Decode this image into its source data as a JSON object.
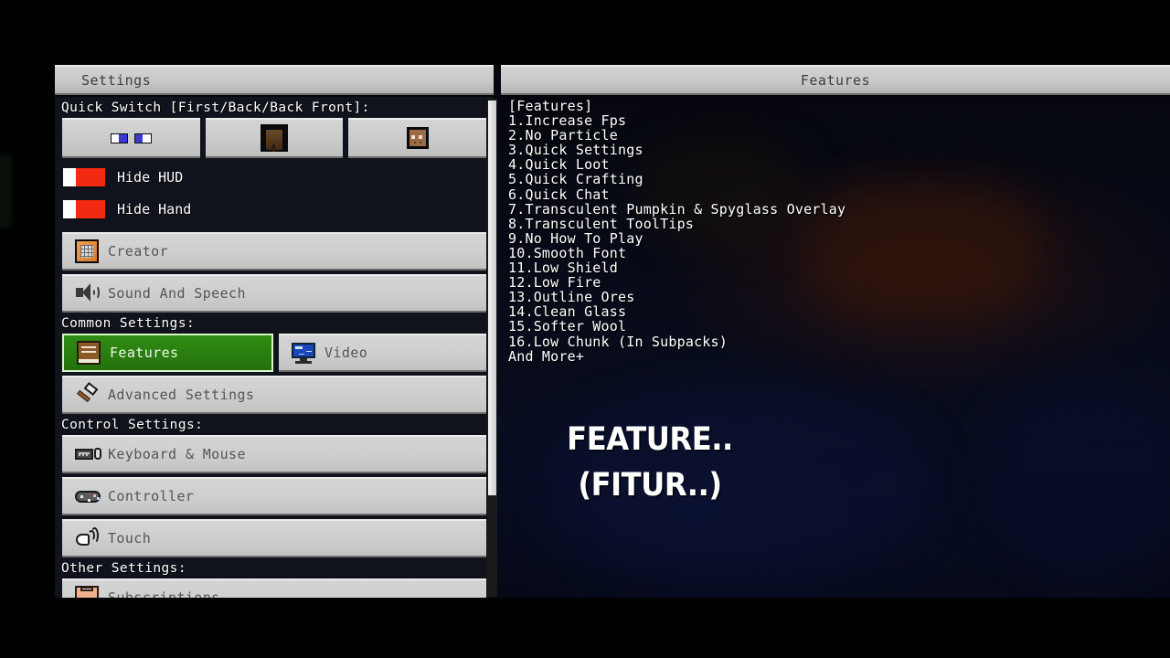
{
  "window": {
    "left_title": "Settings",
    "right_title": "Features"
  },
  "left_panel": {
    "quick_switch_label": "Quick Switch [First/Back/Back Front]:",
    "quick_switch_buttons": [
      {
        "name": "first-person-view",
        "icon": "toggle-pair-icon"
      },
      {
        "name": "back-view",
        "icon": "player-back-icon"
      },
      {
        "name": "back-front-view",
        "icon": "player-face-icon"
      }
    ],
    "toggles": [
      {
        "label": "Hide HUD",
        "state": "off"
      },
      {
        "label": "Hide Hand",
        "state": "off"
      }
    ],
    "top_rows": [
      {
        "label": "Creator",
        "icon": "creator-icon"
      },
      {
        "label": "Sound And Speech",
        "icon": "speaker-icon"
      }
    ],
    "sections": [
      {
        "label": "Common Settings:",
        "rows": [
          {
            "label": "Features",
            "icon": "book-icon",
            "selected": true
          },
          {
            "label": "Video",
            "icon": "monitor-icon",
            "selected": false
          },
          {
            "label": "Advanced Settings",
            "icon": "hammer-icon",
            "selected": false
          }
        ]
      },
      {
        "label": "Control Settings:",
        "rows": [
          {
            "label": "Keyboard & Mouse",
            "icon": "keyboard-mouse-icon",
            "selected": false
          },
          {
            "label": "Controller",
            "icon": "gamepad-icon",
            "selected": false
          },
          {
            "label": "Touch",
            "icon": "touch-icon",
            "selected": false
          }
        ]
      },
      {
        "label": "Other Settings:",
        "rows": [
          {
            "label": "Subscriptions",
            "icon": "clipboard-icon",
            "selected": false
          }
        ]
      }
    ]
  },
  "right_panel": {
    "heading": "[Features]",
    "items": [
      "1.Increase Fps",
      "2.No Particle",
      "3.Quick Settings",
      "4.Quick Loot",
      "5.Quick Crafting",
      "6.Quick Chat",
      "7.Transculent Pumpkin & Spyglass Overlay",
      "8.Transculent ToolTips",
      "9.No How To Play",
      "10.Smooth Font",
      "11.Low Shield",
      "12.Low Fire",
      "13.Outline Ores",
      "14.Clean Glass",
      "15.Softer Wool",
      "16.Low Chunk (In Subpacks)",
      "And More+"
    ],
    "overlay_text_line1": "FEATURE..",
    "overlay_text_line2": "(FITUR..)"
  },
  "colors": {
    "selected_green": "#2a7f10",
    "toggle_red": "#f22a12",
    "panel_gray": "#cfcfcf",
    "titlebar_gray": "#c9c9c9"
  }
}
